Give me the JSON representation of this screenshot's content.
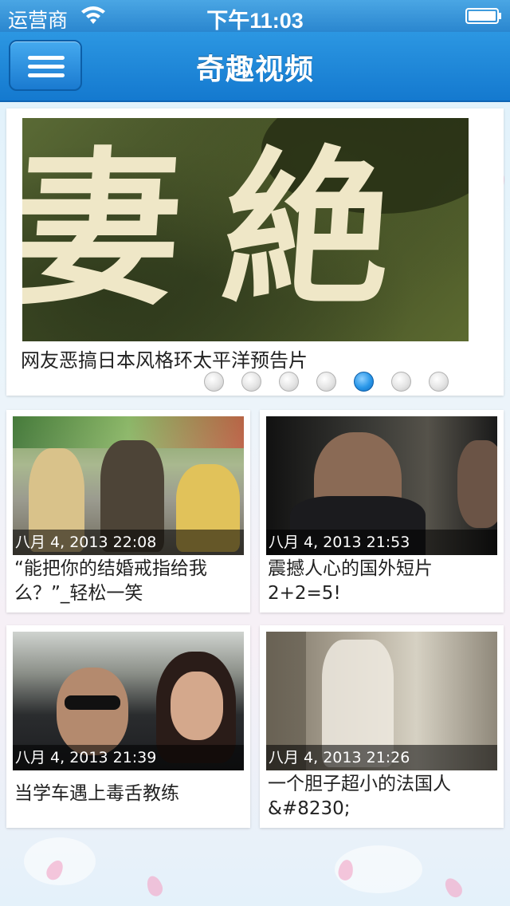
{
  "status_bar": {
    "carrier": "运营商",
    "time": "下午11:03"
  },
  "nav": {
    "title": "奇趣视频",
    "menu_icon": "hamburger-menu-icon"
  },
  "featured": {
    "overlay_text": "妻 絶",
    "caption": "网友恶搞日本风格环太平洋预告片",
    "page_count": 7,
    "active_page": 5
  },
  "videos": [
    {
      "date": "八月 4, 2013 22:08",
      "title": "“能把你的结婚戒指给我么？”_轻松一笑"
    },
    {
      "date": "八月 4, 2013 21:53",
      "title": "震撼人心的国外短片2+2=5!"
    },
    {
      "date": "八月 4, 2013 21:39",
      "title": "当学车遇上毒舌教练"
    },
    {
      "date": "八月 4, 2013 21:26",
      "title": "一个胆子超小的法国人&#8230;"
    }
  ],
  "colors": {
    "nav_blue": "#1d82d6",
    "active_dot": "#2896e8"
  }
}
